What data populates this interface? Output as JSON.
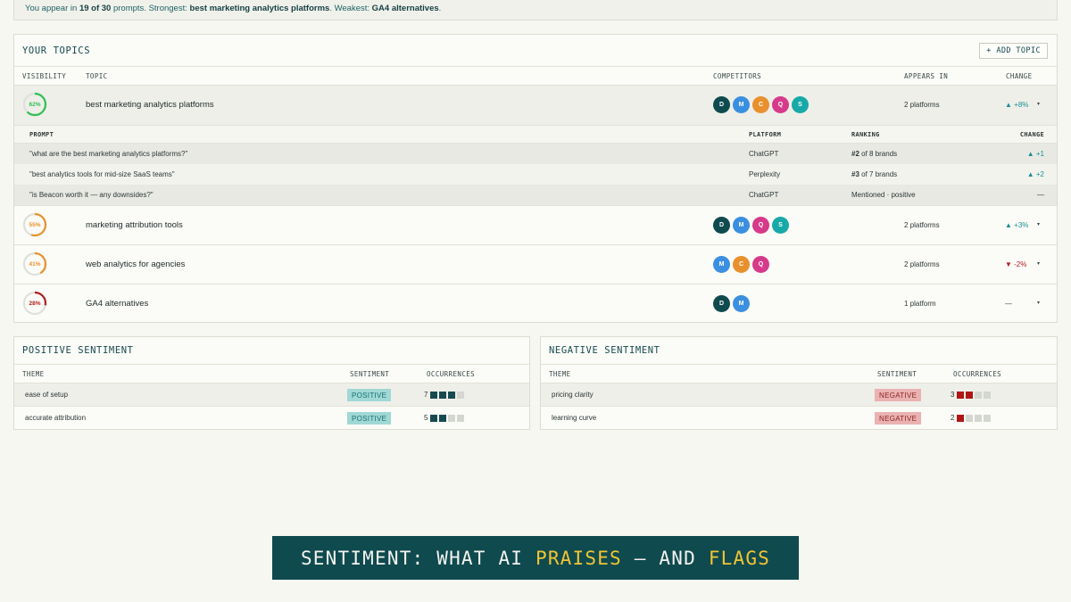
{
  "banner": {
    "pre": "You appear in ",
    "count": "19 of 30",
    "mid": " prompts. Strongest: ",
    "strongest": "best marketing analytics platforms",
    "mid2": ". Weakest: ",
    "weakest": "GA4 alternatives",
    "end": "."
  },
  "topics": {
    "title": "YOUR TOPICS",
    "add_label": "+ ADD TOPIC",
    "columns": {
      "visibility": "VISIBILITY",
      "topic": "TOPIC",
      "competitors": "COMPETITORS",
      "appears": "APPEARS IN",
      "change": "CHANGE"
    },
    "rows": [
      {
        "pct": "62%",
        "pct_value": 62,
        "color": "#2fbf55",
        "name": "best marketing analytics platforms",
        "appears": "2 platforms",
        "change": "▲ +8%",
        "caret": "▾"
      },
      {
        "pct": "55%",
        "pct_value": 55,
        "color": "#e8922e",
        "name": "marketing attribution tools",
        "appears": "2 platforms",
        "change": "▲ +3%",
        "caret": "▾"
      },
      {
        "pct": "41%",
        "pct_value": 41,
        "color": "#e8922e",
        "name": "web analytics for agencies",
        "appears": "2 platforms",
        "change": "▼ -2%",
        "caret": "▾"
      },
      {
        "pct": "28%",
        "pct_value": 28,
        "color": "#b01f1f",
        "name": "GA4 alternatives",
        "appears": "1 platform",
        "change": "—",
        "caret": "▾"
      }
    ],
    "avatars": {
      "d": {
        "letter": "D",
        "color": "#0f4a4f"
      },
      "m": {
        "letter": "M",
        "color": "#3a8fe0"
      },
      "c": {
        "letter": "C",
        "color": "#e8902e"
      },
      "q": {
        "letter": "Q",
        "color": "#d63a8a"
      },
      "s": {
        "letter": "S",
        "color": "#17a9a8"
      }
    },
    "prompts": {
      "columns": {
        "prompt": "PROMPT",
        "platform": "PLATFORM",
        "ranking": "RANKING",
        "change": "CHANGE"
      },
      "rows": [
        {
          "prompt": "\"what are the best marketing analytics platforms?\"",
          "platform": "ChatGPT",
          "rank_bold": "#2",
          "rank_rest": " of 8 brands",
          "change": "▲ +1"
        },
        {
          "prompt": "\"best analytics tools for mid-size SaaS teams\"",
          "platform": "Perplexity",
          "rank_bold": "#3",
          "rank_rest": " of 7 brands",
          "change": "▲ +2"
        },
        {
          "prompt": "\"is Beacon worth it — any downsides?\"",
          "platform": "ChatGPT",
          "rank_bold": "",
          "rank_rest": "Mentioned · positive",
          "change": "—"
        }
      ]
    }
  },
  "positive": {
    "title": "POSITIVE SENTIMENT",
    "columns": {
      "theme": "THEME",
      "sentiment": "SENTIMENT",
      "occurrences": "OCCURRENCES"
    },
    "rows": [
      {
        "theme": "ease of setup",
        "sentiment": "POSITIVE",
        "count": "7",
        "filled": 3
      },
      {
        "theme": "accurate attribution",
        "sentiment": "POSITIVE",
        "count": "5",
        "filled": 2
      }
    ]
  },
  "negative": {
    "title": "NEGATIVE SENTIMENT",
    "columns": {
      "theme": "THEME",
      "sentiment": "SENTIMENT",
      "occurrences": "OCCURRENCES"
    },
    "rows": [
      {
        "theme": "pricing clarity",
        "sentiment": "NEGATIVE",
        "count": "3",
        "filled": 2
      },
      {
        "theme": "learning curve",
        "sentiment": "NEGATIVE",
        "count": "2",
        "filled": 1
      }
    ]
  },
  "caption": {
    "part1": "SENTIMENT: WHAT AI ",
    "hl1": "PRAISES",
    "part2": " — AND ",
    "hl2": "FLAGS"
  }
}
